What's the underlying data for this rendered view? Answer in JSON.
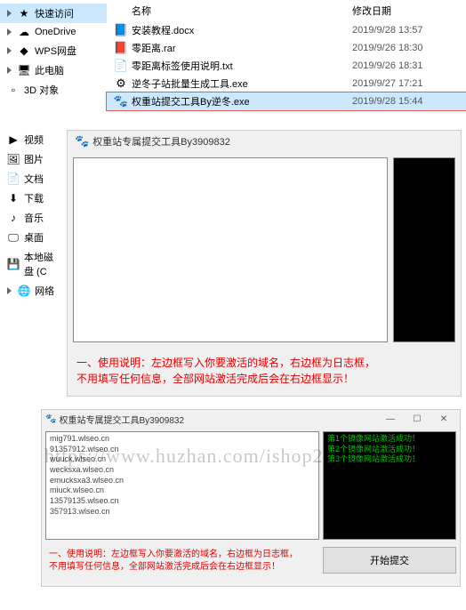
{
  "file_header": {
    "name": "名称",
    "date": "修改日期"
  },
  "sidebar": {
    "items": [
      {
        "icon": "★",
        "label": "快速访问",
        "expandable": true,
        "active": true
      },
      {
        "icon": "☁",
        "label": "OneDrive",
        "expandable": true
      },
      {
        "icon": "◆",
        "label": "WPS网盘",
        "expandable": true
      },
      {
        "icon": "🖥",
        "label": "此电脑",
        "expandable": true
      },
      {
        "icon": "▫",
        "label": "3D 对象"
      },
      {
        "icon": "▶",
        "label": "视频"
      },
      {
        "icon": "🖼",
        "label": "图片"
      },
      {
        "icon": "📄",
        "label": "文档"
      },
      {
        "icon": "⬇",
        "label": "下载"
      },
      {
        "icon": "♪",
        "label": "音乐"
      },
      {
        "icon": "🖵",
        "label": "桌面"
      },
      {
        "icon": "💾",
        "label": "本地磁盘 (C"
      },
      {
        "icon": "🌐",
        "label": "网络",
        "expandable": true
      }
    ]
  },
  "files": [
    {
      "icon": "📘",
      "name": "安装教程.docx",
      "date": "2019/9/28 13:57"
    },
    {
      "icon": "📕",
      "name": "零距离.rar",
      "date": "2019/9/26 18:30"
    },
    {
      "icon": "📄",
      "name": "零距离标签使用说明.txt",
      "date": "2019/9/26 18:31"
    },
    {
      "icon": "⚙",
      "name": "逆冬子站批量生成工具.exe",
      "date": "2019/9/27 17:21"
    },
    {
      "icon": "🐾",
      "name": "权重站提交工具By逆冬.exe",
      "date": "2019/9/28 15:44",
      "selected": true,
      "highlighted": true
    }
  ],
  "app1": {
    "title": "权重站专属提交工具By3909832",
    "instructions_line1": "一、使用说明：左边框写入你要激活的域名，右边框为日志框，",
    "instructions_line2": "不用填写任何信息，全部网站激活完成后会在右边框显示！"
  },
  "app2": {
    "title": "权重站专属提交工具By3909832",
    "textarea": "mig791.wlseo.cn\n91357912.wlseo.cn\nwuuck.wlseo.cn\nwecksxa.wlseo.cn\nemucksxa3.wlseo.cn\nmiuck.wlseo.cn\n13579135.wlseo.cn\n357913.wlseo.cn",
    "log": "第1个镜像网站激活成功！\n第2个镜像网站激活成功！\n第3个镜像网站激活成功！",
    "instructions_line1": "一、使用说明：左边框写入你要激活的域名，右边框为日志框，",
    "instructions_line2": "不用填写任何信息，全部网站激活完成后会在右边框显示！",
    "submit_label": "开始提交"
  },
  "watermark": "https://www.huzhan.com/ishop24443"
}
